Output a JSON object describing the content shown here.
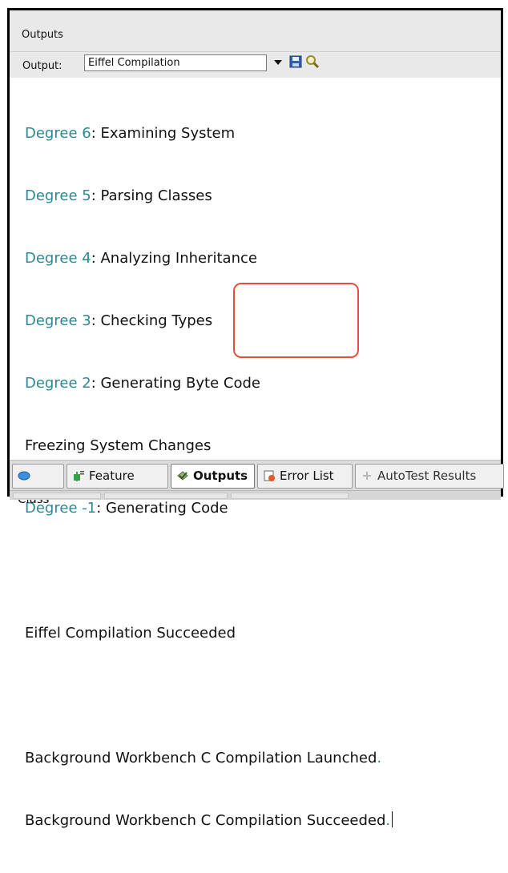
{
  "panel": {
    "title": "Outputs"
  },
  "toolbar": {
    "output_label": "Output:",
    "selected_output": "Eiffel Compilation",
    "save_icon": "save-icon",
    "find_icon": "search-icon"
  },
  "console": {
    "lines": [
      {
        "prefix": "Degree 6",
        "suffix": ": Examining System"
      },
      {
        "prefix": "Degree 5",
        "suffix": ": Parsing Classes"
      },
      {
        "prefix": "Degree 4",
        "suffix": ": Analyzing Inheritance"
      },
      {
        "prefix": "Degree 3",
        "suffix": ": Checking Types"
      },
      {
        "prefix": "Degree 2",
        "suffix": ": Generating Byte Code"
      },
      {
        "plain": "Freezing System Changes"
      },
      {
        "prefix": "Degree -1",
        "suffix": ": Generating Code"
      },
      {
        "plain": "Eiffel Compilation Succeeded"
      },
      {
        "a": "Background Workbench ",
        "b": "C Compilation",
        "c": " Launched",
        "dot": "."
      },
      {
        "a": "Background Workbench ",
        "b": "C Compilation",
        "c": " Succeeded",
        "dot": "."
      }
    ]
  },
  "tabs": [
    {
      "label": "Class",
      "icon": "class-icon"
    },
    {
      "label": "Feature",
      "icon": "feature-icon"
    },
    {
      "label": "Outputs",
      "icon": "outputs-icon",
      "active": true
    },
    {
      "label": "Error List",
      "icon": "error-list-icon"
    },
    {
      "label": "AutoTest Results",
      "icon": "autotest-icon"
    }
  ],
  "colors": {
    "keyword": "#2a8a93",
    "highlight": "#e0533a"
  }
}
